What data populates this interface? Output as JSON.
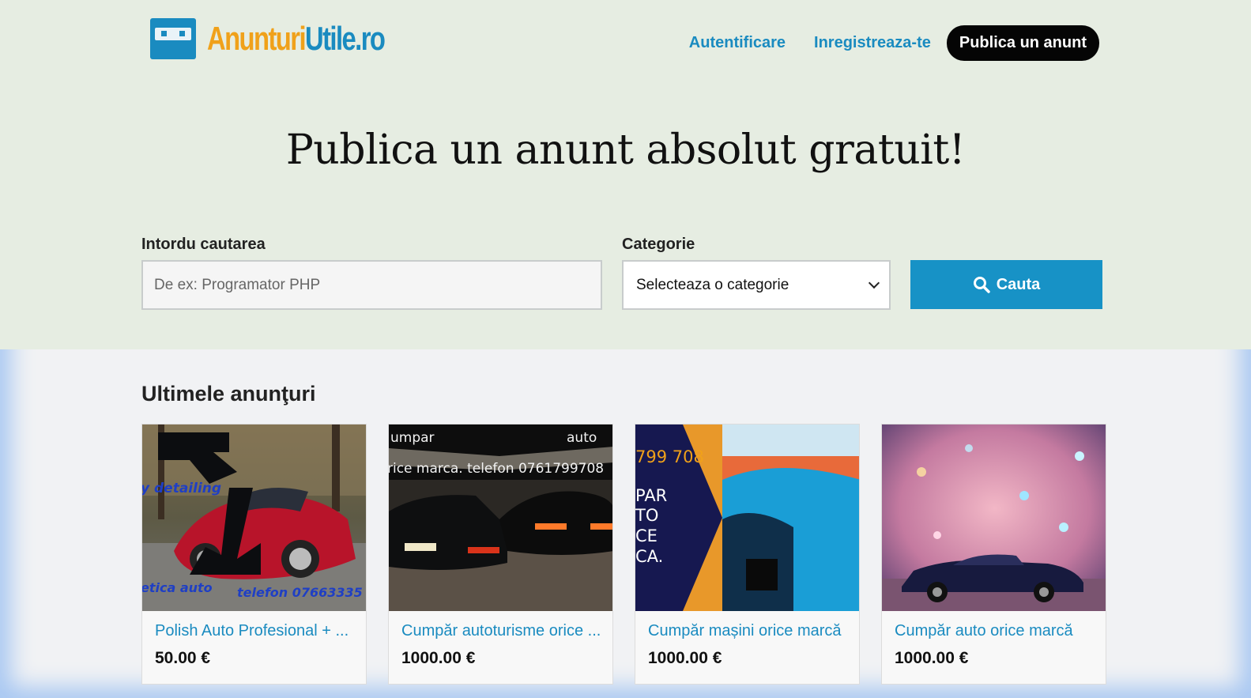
{
  "brand": {
    "part1": "AnunturiUtile",
    "part1a": "Anunturi",
    "part1b": "Utile",
    "part2": ".ro"
  },
  "nav": {
    "login": "Autentificare",
    "register": "Inregistreaza-te",
    "publish": "Publica un anunt"
  },
  "hero": {
    "headline": "Publica un anunt absolut gratuit!"
  },
  "search": {
    "label": "Intordu cautarea",
    "placeholder": "De ex: Programator PHP",
    "category_label": "Categorie",
    "category_selected": "Selecteaza o categorie",
    "button_label": "Cauta"
  },
  "listings": {
    "title": "Ultimele anunţuri",
    "items": [
      {
        "title": "Polish Auto Profesional + ...",
        "price": "50.00 €",
        "image_text": {
          "t1": "y detailing",
          "t2": "etica auto",
          "t3": "telefon 07663335"
        }
      },
      {
        "title": "Cumpăr autoturisme orice ...",
        "price": "1000.00 €",
        "image_text": {
          "t1": "umpar",
          "t2": "auto",
          "t3": "rice marca. telefon 0761799708"
        }
      },
      {
        "title": "Cumpăr mașini orice marcă",
        "price": "1000.00 €",
        "image_text": {
          "t1": "799 708",
          "t2": "PAR",
          "t3": "TO",
          "t4": "CE",
          "t5": "CA."
        }
      },
      {
        "title": "Cumpăr auto orice marcă",
        "price": "1000.00 €",
        "image_text": {}
      }
    ]
  },
  "colors": {
    "brand_orange": "#f0a11a",
    "brand_blue": "#1a8bc0",
    "hero_bg": "#e6ede2"
  },
  "icons": {
    "search": "search-icon",
    "logo": "logo-icon"
  }
}
